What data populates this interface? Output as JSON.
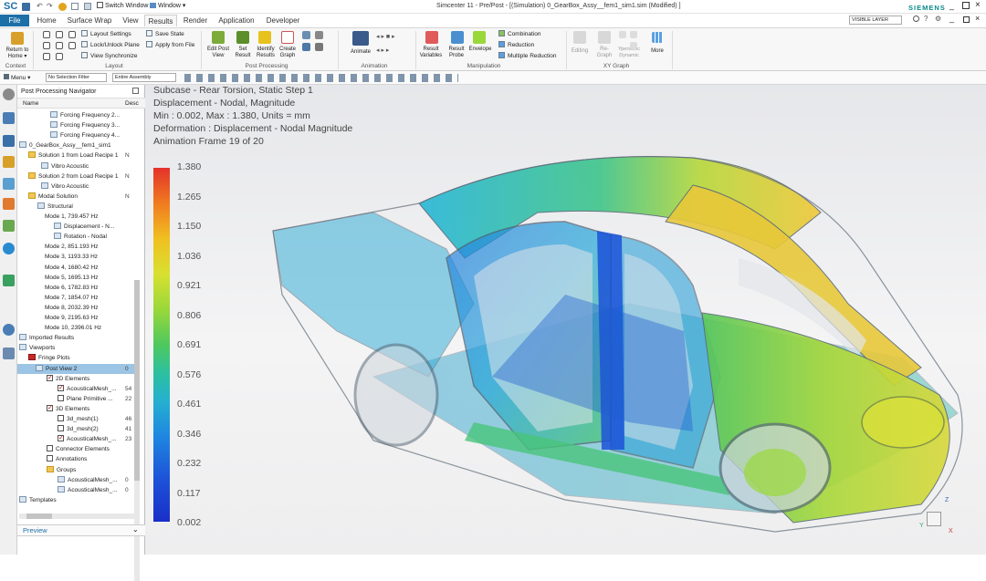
{
  "app": {
    "logo": "SC",
    "title": "Simcenter 11 - Pre/Post - [(Simulation) 0_GearBox_Assy__fem1_sim1.sim (Modified) ]",
    "brand": "SIEMENS",
    "switch_window": "Switch Window",
    "window_menu": "Window ▾",
    "layer_filter": "VISIBLE LAYER"
  },
  "tabs": [
    "File",
    "Home",
    "Surface Wrap",
    "View",
    "Results",
    "Render",
    "Application",
    "Developer"
  ],
  "ribbon": {
    "context": {
      "label": "Context",
      "return_home": "Return to\nHome ▾"
    },
    "layout": {
      "label": "Layout",
      "items": [
        "Layout Settings",
        "Lock/Unlock Plane",
        "View Synchronize"
      ],
      "save_state": "Save State",
      "apply_from_file": "Apply from File"
    },
    "post_processing": {
      "label": "Post Processing",
      "buttons": [
        "Edit Post\nView",
        "Set\nResult",
        "Identify\nResults",
        "Create\nGraph"
      ]
    },
    "animation": {
      "label": "Animation",
      "button": "Animate"
    },
    "manipulation": {
      "label": "Manipulation",
      "buttons": [
        "Result\nVariables",
        "Result\nProbe",
        "Envelope"
      ],
      "items": [
        "Combination",
        "Reduction",
        "Multiple Reduction"
      ]
    },
    "xy_graph": {
      "label": "XY Graph",
      "buttons": [
        "Editing",
        "Re-\nGraph",
        "Ypersonic\nDynamic"
      ],
      "more": "More"
    }
  },
  "toolbar2": {
    "menu": "Menu ▾",
    "selection_filter": "No Selection Filter",
    "assembly": "Entire Assembly"
  },
  "navigator": {
    "title": "Post Processing Navigator",
    "col_name": "Name",
    "col_desc": "Desc",
    "rows": [
      {
        "text": "Forcing Frequency 2...",
        "indent": 36,
        "icon": "mode",
        "val": ""
      },
      {
        "text": "Forcing Frequency 3...",
        "indent": 36,
        "icon": "mode",
        "val": ""
      },
      {
        "text": "Forcing Frequency 4...",
        "indent": 36,
        "icon": "mode",
        "val": ""
      },
      {
        "text": "0_GearBox_Assy__fem1_sim1",
        "indent": 2,
        "icon": "mode",
        "val": ""
      },
      {
        "text": "Solution 1 from Load Recipe 1",
        "indent": 12,
        "icon": "folder",
        "val": "N"
      },
      {
        "text": "Vibro Acoustic",
        "indent": 26,
        "icon": "mode",
        "val": ""
      },
      {
        "text": "Solution 2 from Load Recipe 1",
        "indent": 12,
        "icon": "folder",
        "val": "N"
      },
      {
        "text": "Vibro Acoustic",
        "indent": 26,
        "icon": "mode",
        "val": ""
      },
      {
        "text": "Modal Solution",
        "indent": 12,
        "icon": "folder",
        "val": "N"
      },
      {
        "text": "Structural",
        "indent": 22,
        "icon": "mode",
        "val": ""
      },
      {
        "text": "Mode 1, 739.457 Hz",
        "indent": 30,
        "icon": "none",
        "val": ""
      },
      {
        "text": "Displacement - N...",
        "indent": 40,
        "icon": "mode",
        "val": ""
      },
      {
        "text": "Rotation - Nodal",
        "indent": 40,
        "icon": "mode",
        "val": ""
      },
      {
        "text": "Mode 2, 851.193 Hz",
        "indent": 30,
        "icon": "none",
        "val": ""
      },
      {
        "text": "Mode 3, 1193.33 Hz",
        "indent": 30,
        "icon": "none",
        "val": ""
      },
      {
        "text": "Mode 4, 1680.42 Hz",
        "indent": 30,
        "icon": "none",
        "val": ""
      },
      {
        "text": "Mode 5, 1695.13 Hz",
        "indent": 30,
        "icon": "none",
        "val": ""
      },
      {
        "text": "Mode 6, 1782.83 Hz",
        "indent": 30,
        "icon": "none",
        "val": ""
      },
      {
        "text": "Mode 7, 1854.07 Hz",
        "indent": 30,
        "icon": "none",
        "val": ""
      },
      {
        "text": "Mode 8, 2032.39 Hz",
        "indent": 30,
        "icon": "none",
        "val": ""
      },
      {
        "text": "Mode 9, 2195.63 Hz",
        "indent": 30,
        "icon": "none",
        "val": ""
      },
      {
        "text": "Mode 10, 2396.01 Hz",
        "indent": 30,
        "icon": "none",
        "val": ""
      },
      {
        "text": "Imported Results",
        "indent": 2,
        "icon": "mode",
        "val": ""
      },
      {
        "text": "Viewports",
        "indent": 2,
        "icon": "mode",
        "val": ""
      },
      {
        "text": "Fringe Plots",
        "indent": 12,
        "icon": "red",
        "val": ""
      },
      {
        "text": "Post View 2",
        "indent": 20,
        "icon": "mode",
        "val": "0",
        "selected": true
      },
      {
        "text": "2D Elements",
        "indent": 32,
        "icon": "chkon",
        "val": ""
      },
      {
        "text": "AcousticalMesh_...",
        "indent": 44,
        "icon": "chkon",
        "val": "54"
      },
      {
        "text": "Plane Primitive ...",
        "indent": 44,
        "icon": "chk",
        "val": "22"
      },
      {
        "text": "3D Elements",
        "indent": 32,
        "icon": "chkon",
        "val": ""
      },
      {
        "text": "3d_mesh(1)",
        "indent": 44,
        "icon": "chk",
        "val": "46"
      },
      {
        "text": "3d_mesh(2)",
        "indent": 44,
        "icon": "chk",
        "val": "41"
      },
      {
        "text": "AcousticalMesh_...",
        "indent": 44,
        "icon": "chkon",
        "val": "23"
      },
      {
        "text": "Connector Elements",
        "indent": 32,
        "icon": "chk",
        "val": ""
      },
      {
        "text": "Annotations",
        "indent": 32,
        "icon": "chk",
        "val": ""
      },
      {
        "text": "Groups",
        "indent": 32,
        "icon": "folder",
        "val": ""
      },
      {
        "text": "AcousticalMesh_...",
        "indent": 44,
        "icon": "mode",
        "val": "0"
      },
      {
        "text": "AcousticalMesh_...",
        "indent": 44,
        "icon": "mode",
        "val": "0"
      },
      {
        "text": "Templates",
        "indent": 2,
        "icon": "mode",
        "val": ""
      }
    ],
    "preview": "Preview"
  },
  "viewport": {
    "overlay_lines": [
      "Subcase - Rear Torsion, Static Step 1",
      "Displacement - Nodal, Magnitude",
      "Min : 0.002, Max : 1.380, Units = mm",
      "Deformation : Displacement - Nodal Magnitude",
      "Animation Frame 19 of 20"
    ],
    "legend_values": [
      "1.380",
      "1.265",
      "1.150",
      "1.036",
      "0.921",
      "0.806",
      "0.691",
      "0.576",
      "0.461",
      "0.346",
      "0.232",
      "0.117",
      "0.002"
    ],
    "triad_labels": [
      "Z",
      "Y",
      "X"
    ]
  },
  "colors": {
    "file_tab": "#1d6fa8",
    "accent": "#1d6fa8",
    "legend_max": "#e3322a",
    "legend_min": "#1a2fc8"
  }
}
